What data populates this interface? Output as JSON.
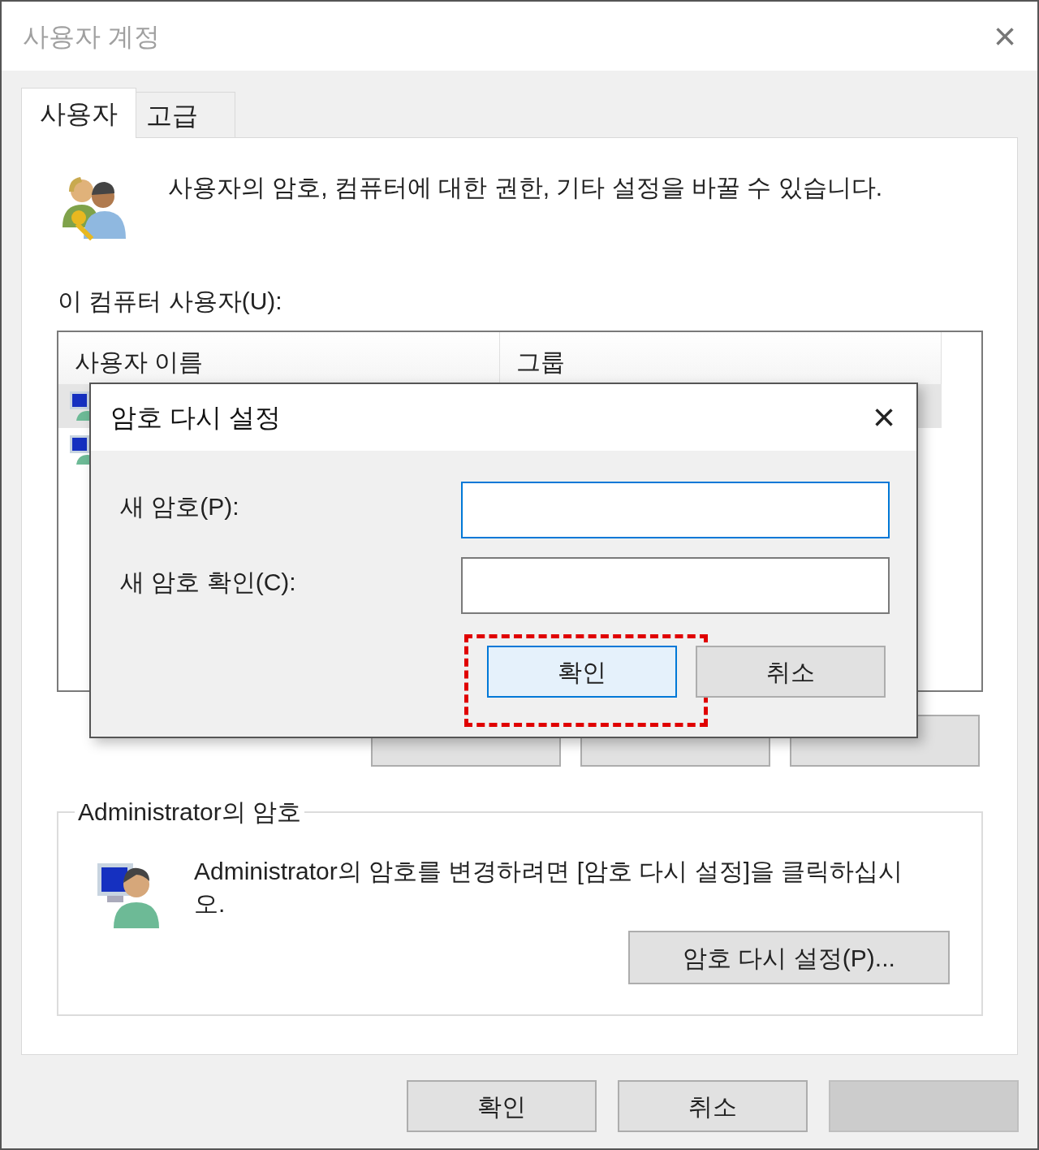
{
  "window": {
    "title": "사용자 계정",
    "close": "×"
  },
  "tabs": [
    {
      "label": "사용자",
      "selected": true
    },
    {
      "label": "고급",
      "selected": false
    }
  ],
  "description": "사용자의 암호, 컴퓨터에 대한 권한, 기타 설정을 바꿀 수 있습니다.",
  "users_label": "이 컴퓨터 사용자(U):",
  "table": {
    "columns": [
      "사용자 이름",
      "그룹"
    ],
    "rows": [
      {
        "selected": true
      },
      {
        "selected": false
      }
    ]
  },
  "admin_group": {
    "title": "Administrator의 암호",
    "text": "Administrator의 암호를 변경하려면 [암호 다시 설정]을 클릭하십시오.",
    "button": "암호 다시 설정(P)..."
  },
  "footer_buttons": [
    {
      "label": "확인",
      "disabled": false
    },
    {
      "label": "취소",
      "disabled": false
    },
    {
      "disabled": true
    }
  ],
  "dialog": {
    "title": "암호 다시 설정",
    "close": "×",
    "fields": [
      {
        "label": "새 암호(P):",
        "focused": true
      },
      {
        "label": "새 암호 확인(C):",
        "focused": false
      }
    ],
    "buttons": [
      {
        "label": "확인",
        "default": true,
        "highlighted": true
      },
      {
        "label": "취소",
        "default": false,
        "highlighted": false
      }
    ]
  }
}
